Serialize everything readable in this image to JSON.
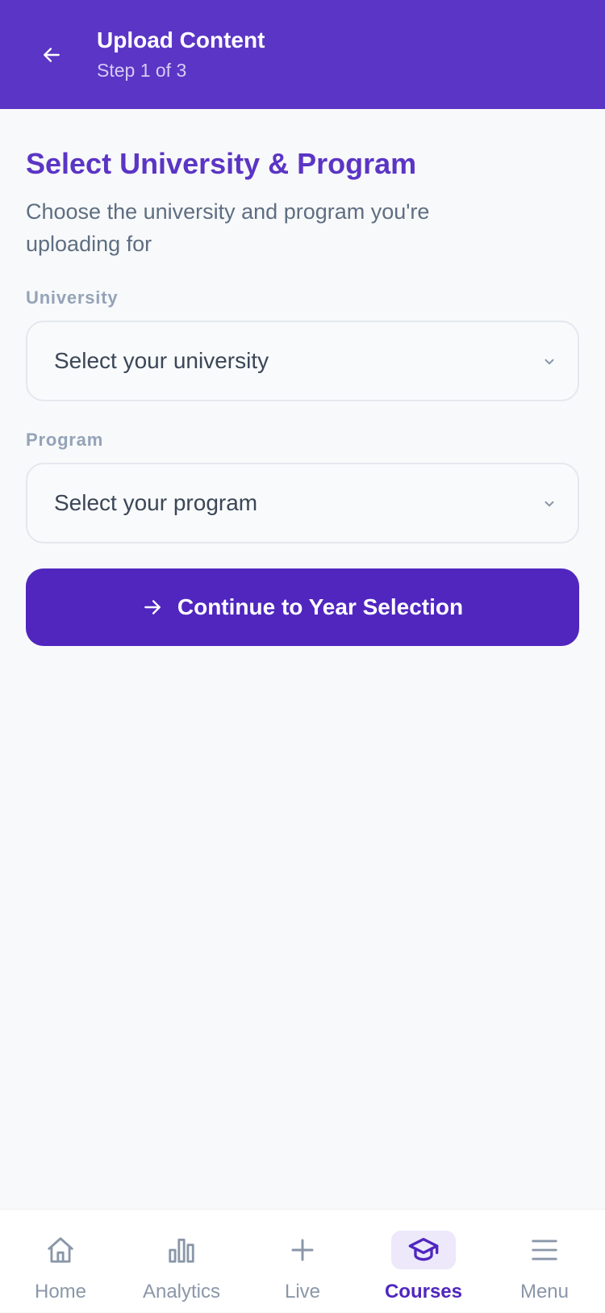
{
  "header": {
    "title": "Upload Content",
    "subtitle": "Step 1 of 3",
    "back_icon": "arrow-left-icon"
  },
  "section": {
    "title": "Select University & Program",
    "description": "Choose the university and program you're uploading for"
  },
  "fields": {
    "university": {
      "label": "University",
      "placeholder": "Select your university"
    },
    "program": {
      "label": "Program",
      "placeholder": "Select your program"
    }
  },
  "cta": {
    "label": "Continue to Year Selection",
    "icon": "arrow-right-icon"
  },
  "nav": {
    "items": [
      {
        "label": "Home",
        "icon": "home-icon"
      },
      {
        "label": "Analytics",
        "icon": "bar-chart-icon"
      },
      {
        "label": "Live",
        "icon": "plus-icon"
      },
      {
        "label": "Courses",
        "icon": "graduation-cap-icon"
      },
      {
        "label": "Menu",
        "icon": "menu-icon"
      }
    ],
    "active": "Courses"
  },
  "colors": {
    "primary": "#5b35c5",
    "button": "#5026bf",
    "background": "#f8f9fa",
    "inactive": "#8a97a8"
  }
}
